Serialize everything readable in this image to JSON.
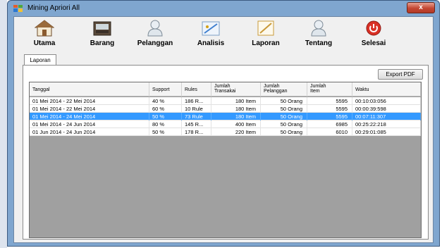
{
  "window": {
    "title": "Mining Apriori All",
    "close_label": "x"
  },
  "toolbar": {
    "items": [
      {
        "label": "Utama",
        "icon": "house-icon"
      },
      {
        "label": "Barang",
        "icon": "box-icon"
      },
      {
        "label": "Pelanggan",
        "icon": "user-icon"
      },
      {
        "label": "Analisis",
        "icon": "analysis-icon"
      },
      {
        "label": "Laporan",
        "icon": "report-icon"
      },
      {
        "label": "Tentang",
        "icon": "about-user-icon"
      },
      {
        "label": "Selesai",
        "icon": "power-icon"
      }
    ]
  },
  "tabs": [
    {
      "label": "Laporan",
      "active": true
    }
  ],
  "report": {
    "export_label": "Export PDF",
    "columns": [
      {
        "line1": "Tanggal",
        "line2": ""
      },
      {
        "line1": "Support",
        "line2": ""
      },
      {
        "line1": "Rules",
        "line2": ""
      },
      {
        "line1": "Jumlah",
        "line2": "Transakai"
      },
      {
        "line1": "Jumlah",
        "line2": "Pelanggan"
      },
      {
        "line1": "Jumlah",
        "line2": "Item"
      },
      {
        "line1": "Waktu",
        "line2": ""
      }
    ],
    "rows": [
      {
        "tanggal": "01 Mei 2014 - 22 Mei 2014",
        "support": "40 %",
        "rules": "186 R...",
        "transaksi": "180 Item",
        "pelanggan": "50 Orang",
        "item": "5595",
        "waktu": "00:10:03:056",
        "selected": false
      },
      {
        "tanggal": "01 Mei 2014 - 22 Mei 2014",
        "support": "60 %",
        "rules": "10 Rule",
        "transaksi": "180 Item",
        "pelanggan": "50 Orang",
        "item": "5595",
        "waktu": "00:00:39:598",
        "selected": false
      },
      {
        "tanggal": "01 Mei 2014 - 24 Mei 2014",
        "support": "50 %",
        "rules": "73 Rule",
        "transaksi": "180 Item",
        "pelanggan": "50 Orang",
        "item": "5595",
        "waktu": "00:07:11:307",
        "selected": true
      },
      {
        "tanggal": "01 Mei 2014 - 24 Jun 2014",
        "support": "80 %",
        "rules": "145 R...",
        "transaksi": "400 Item",
        "pelanggan": "50 Orang",
        "item": "6985",
        "waktu": "00:25:22:218",
        "selected": false
      },
      {
        "tanggal": "01 Jun 2014 - 24 Jun 2014",
        "support": "50 %",
        "rules": "178 R...",
        "transaksi": "220 Item",
        "pelanggan": "50 Orang",
        "item": "6010",
        "waktu": "00:29:01:085",
        "selected": false
      }
    ]
  },
  "colors": {
    "selection": "#3399ff",
    "grid_background": "#a0a0a0",
    "frame": "#7fa6cf"
  }
}
